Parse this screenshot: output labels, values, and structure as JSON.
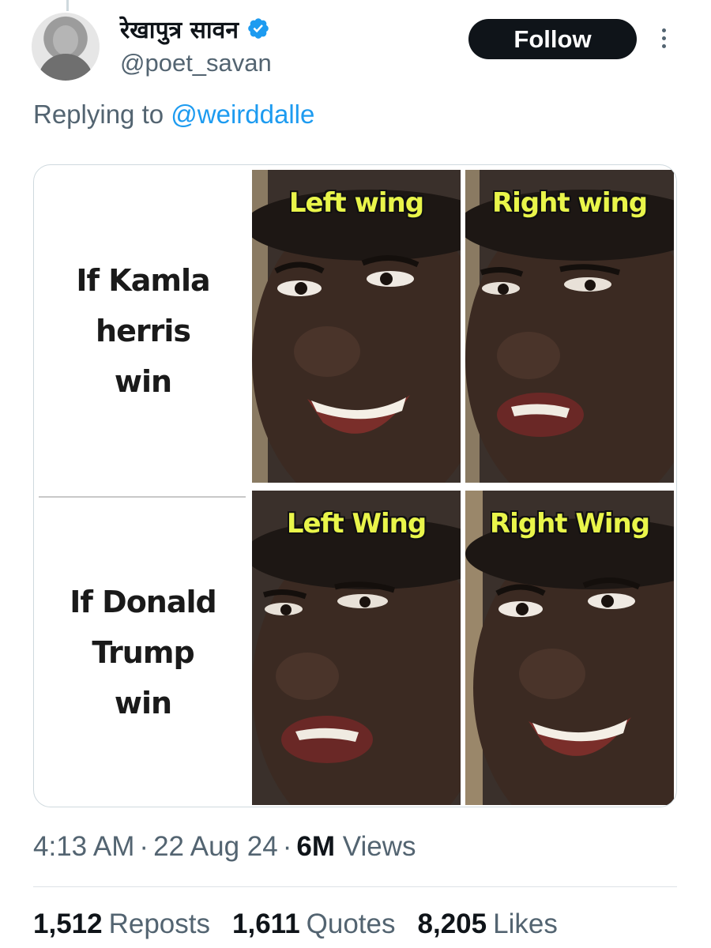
{
  "author": {
    "display_name": "रेखापुत्र सावन",
    "handle": "@poet_savan",
    "verified": true
  },
  "follow_label": "Follow",
  "reply": {
    "prefix": "Replying to",
    "mention": "@weirddalle"
  },
  "meme": {
    "row_top_condition": "If Kamla\nherris\nwin",
    "row_bottom_condition": "If Donald\nTrump\nwin",
    "panels": [
      {
        "label": "Left wing",
        "expression": "smiling"
      },
      {
        "label": "Right wing",
        "expression": "disappointed"
      },
      {
        "label": "Left Wing",
        "expression": "disappointed"
      },
      {
        "label": "Right Wing",
        "expression": "smiling"
      }
    ],
    "caption_color": "#e9f54a"
  },
  "meta": {
    "time": "4:13 AM",
    "date": "22 Aug 24",
    "views_count": "6M",
    "views_label": "Views"
  },
  "stats": {
    "reposts_count": "1,512",
    "reposts_label": "Reposts",
    "quotes_count": "1,611",
    "quotes_label": "Quotes",
    "likes_count": "8,205",
    "likes_label": "Likes"
  },
  "colors": {
    "accent": "#1d9bf0",
    "text_secondary": "#536471",
    "button_bg": "#0f1419"
  }
}
